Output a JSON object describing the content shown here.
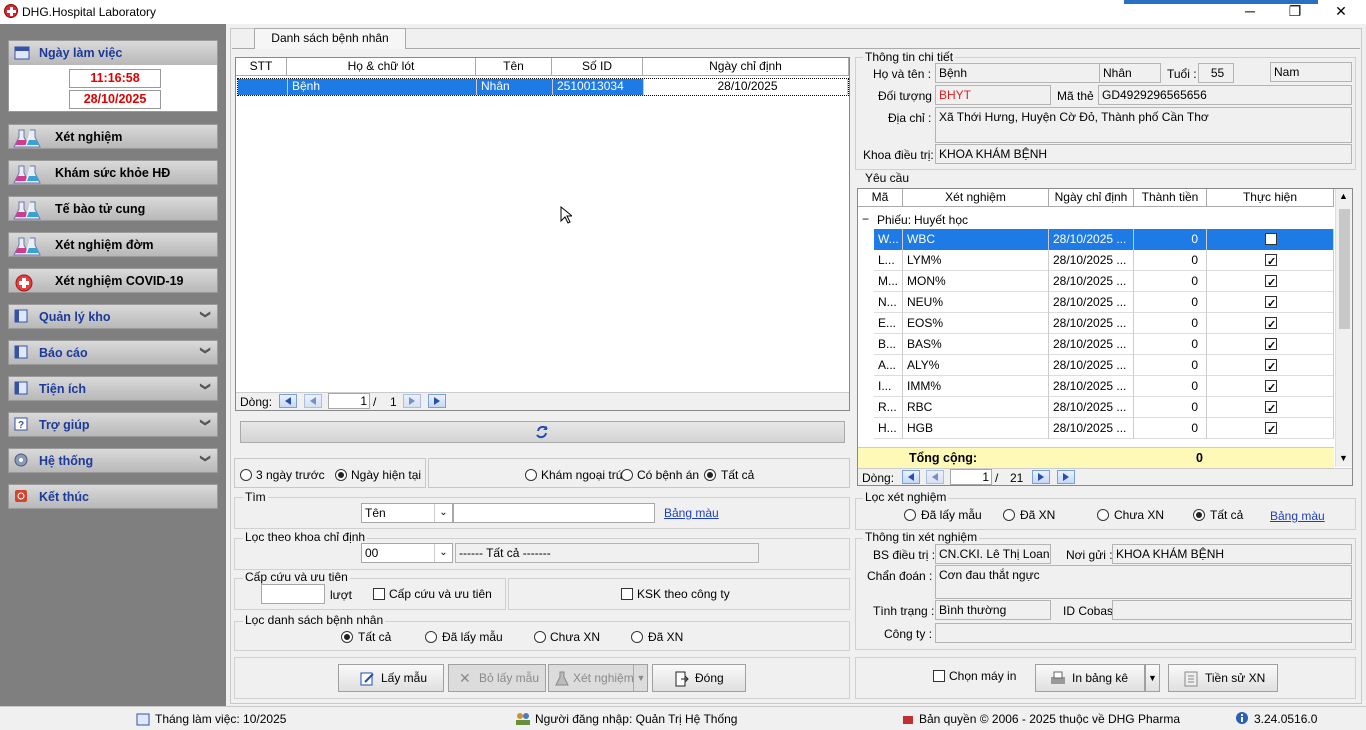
{
  "window": {
    "title": "DHG.Hospital Laboratory",
    "min": "─",
    "max": "❐",
    "close": "✕"
  },
  "sidebar": {
    "workday": "Ngày làm việc",
    "time": "11:16:58",
    "date": "28/10/2025",
    "items": [
      {
        "label": "Xét nghiệm",
        "icon": "flask-icon"
      },
      {
        "label": "Khám sức khỏe HĐ",
        "icon": "flask-icon"
      },
      {
        "label": "Tế bào tử cung",
        "icon": "flask-icon"
      },
      {
        "label": "Xét nghiệm đờm",
        "icon": "flask-icon"
      },
      {
        "label": "Xét nghiệm COVID-19",
        "icon": "virus-icon"
      }
    ],
    "groups": [
      {
        "label": "Quản lý kho",
        "icon": "book-icon"
      },
      {
        "label": "Báo cáo",
        "icon": "book-icon"
      },
      {
        "label": "Tiện ích",
        "icon": "book-icon"
      },
      {
        "label": "Trợ giúp",
        "icon": "help-icon"
      },
      {
        "label": "Hệ thống",
        "icon": "gear-icon"
      },
      {
        "label": "Kết thúc",
        "icon": "exit-icon"
      }
    ]
  },
  "tab": "Danh sách bệnh nhân",
  "patients": {
    "columns": [
      "STT",
      "Họ & chữ lót",
      "Tên",
      "Số ID",
      "Ngày chỉ định"
    ],
    "rows": [
      {
        "stt": "",
        "ho": "Bệnh",
        "ten": "Nhân",
        "id": "2510013034",
        "ngay": "28/10/2025"
      }
    ],
    "pager": {
      "label": "Dòng:",
      "page": "1",
      "sep": "/",
      "total": "1"
    }
  },
  "filters": {
    "date_opts": [
      "3 ngày trước",
      "Ngày hiện tại"
    ],
    "type_opts": [
      "Khám ngoại trú",
      "Có bệnh án",
      "Tất cả"
    ],
    "search_label": "Tìm",
    "search_field": "Tên",
    "search_value": "",
    "bang_mau": "Bảng màu",
    "dept_label": "Lọc theo khoa chỉ định",
    "dept_code": "00",
    "dept_name": "------ Tất cả -------",
    "emerg_label": "Cấp cứu và ưu tiên",
    "emerg_unit": "lượt",
    "emerg_chk": "Cấp cứu và ưu tiên",
    "ksk_chk": "KSK theo công ty",
    "list_label": "Lọc danh sách bệnh nhân",
    "list_opts": [
      "Tất cả",
      "Đã lấy mẫu",
      "Chưa XN",
      "Đã XN"
    ]
  },
  "buttons": {
    "lay_mau": "Lấy mẫu",
    "bo_lay_mau": "Bỏ lấy mẫu",
    "xet_nghiem": "Xét nghiệm",
    "dong": "Đóng",
    "chon_may_in": "Chọn máy in",
    "in_bang_ke": "In bảng kê",
    "tien_su": "Tiền sử XN"
  },
  "detail": {
    "title": "Thông tin chi tiết",
    "name_label": "Họ và tên :",
    "ho": "Bệnh",
    "ten": "Nhân",
    "age_label": "Tuổi :",
    "age": "55",
    "sex": "Nam",
    "obj_label": "Đối tượng :",
    "obj": "BHYT",
    "card_label": "Mã thẻ :",
    "card": "GD4929296565656",
    "addr_label": "Địa chỉ :",
    "addr": "Xã Thới Hưng, Huyện Cờ Đỏ, Thành phố Cần Thơ",
    "dept_label": "Khoa điều trị:",
    "dept": "KHOA KHÁM BỆNH"
  },
  "requests": {
    "title": "Yêu cầu",
    "columns": [
      "Mã",
      "Xét nghiệm",
      "Ngày chỉ định",
      "Thành tiền",
      "Thực hiện"
    ],
    "group_label": "Phiếu:",
    "group_name": "Huyết học",
    "rows": [
      {
        "ma": "W...",
        "xn": "WBC",
        "ngay": "28/10/2025 ...",
        "tien": "0"
      },
      {
        "ma": "L...",
        "xn": "LYM%",
        "ngay": "28/10/2025 ...",
        "tien": "0"
      },
      {
        "ma": "M...",
        "xn": "MON%",
        "ngay": "28/10/2025 ...",
        "tien": "0"
      },
      {
        "ma": "N...",
        "xn": "NEU%",
        "ngay": "28/10/2025 ...",
        "tien": "0"
      },
      {
        "ma": "E...",
        "xn": "EOS%",
        "ngay": "28/10/2025 ...",
        "tien": "0"
      },
      {
        "ma": "B...",
        "xn": "BAS%",
        "ngay": "28/10/2025 ...",
        "tien": "0"
      },
      {
        "ma": "A...",
        "xn": "ALY%",
        "ngay": "28/10/2025 ...",
        "tien": "0"
      },
      {
        "ma": "I...",
        "xn": "IMM%",
        "ngay": "28/10/2025 ...",
        "tien": "0"
      },
      {
        "ma": "R...",
        "xn": "RBC",
        "ngay": "28/10/2025 ...",
        "tien": "0"
      },
      {
        "ma": "H...",
        "xn": "HGB",
        "ngay": "28/10/2025 ...",
        "tien": "0"
      }
    ],
    "total_label": "Tổng cộng:",
    "total": "0",
    "pager": {
      "label": "Dòng:",
      "page": "1",
      "sep": "/",
      "total": "21"
    }
  },
  "test_filter": {
    "title": "Lọc xét nghiệm",
    "opts": [
      "Đã lấy mẫu",
      "Đã XN",
      "Chưa XN",
      "Tất cả"
    ],
    "bang_mau": "Bảng màu"
  },
  "test_info": {
    "title": "Thông tin xét nghiệm",
    "doctor_label": "BS điều trị :",
    "doctor": "CN.CKI. Lê Thị Loan An",
    "send_label": "Nơi gửi :",
    "send": "KHOA KHÁM BỆNH",
    "diag_label": "Chẩn đoán :",
    "diag": "Cơn đau thắt ngực",
    "status_label": "Tình trạng :",
    "status": "Bình thường",
    "cobas_label": "ID Cobas:",
    "cobas": "",
    "company_label": "Công ty :",
    "company": ""
  },
  "status": {
    "month": "Tháng làm việc: 10/2025",
    "user": "Người đăng nhập: Quản Trị Hệ Thống",
    "copyright": "Bản quyền © 2006 - 2025 thuộc về DHG Pharma",
    "version": "3.24.0516.0"
  }
}
